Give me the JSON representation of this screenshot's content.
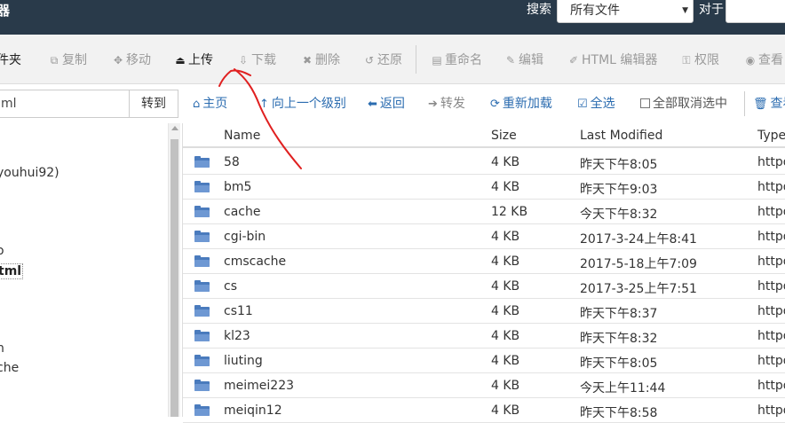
{
  "header": {
    "app_title": "器",
    "search_label": "搜索",
    "search_scope": "所有文件",
    "for_label": "对于",
    "search_placeholder": ""
  },
  "toolbar": {
    "items": [
      {
        "label": "件夹",
        "icon": "folder-icon"
      },
      {
        "label": "复制",
        "icon": "copy-icon"
      },
      {
        "label": "移动",
        "icon": "move-icon"
      },
      {
        "label": "上传",
        "icon": "upload-icon"
      },
      {
        "label": "下载",
        "icon": "download-icon"
      },
      {
        "label": "删除",
        "icon": "delete-icon"
      },
      {
        "label": "还原",
        "icon": "restore-icon"
      },
      {
        "label": "重命名",
        "icon": "file-icon"
      },
      {
        "label": "编辑",
        "icon": "pencil-icon"
      },
      {
        "label": "HTML 编辑器",
        "icon": "edit-icon"
      },
      {
        "label": "权限",
        "icon": "key-icon"
      },
      {
        "label": "查看",
        "icon": "eye-icon"
      }
    ]
  },
  "path": {
    "value": "ml",
    "go_label": "转到"
  },
  "nav": {
    "home": "主页",
    "up_one_level": "向上一个级别",
    "back": "返回",
    "forward": "转发",
    "reload": "重新加载",
    "select_all": "全选",
    "deselect_all": "全部取消选中",
    "view_trash": "查看"
  },
  "tree": {
    "items": [
      "youhui92)",
      "o",
      "tml",
      "n",
      "che"
    ]
  },
  "table": {
    "columns": [
      "Name",
      "Size",
      "Last Modified",
      "Type"
    ],
    "rows": [
      {
        "name": "58",
        "size": "4 KB",
        "modified": "昨天下午8:05",
        "type": "httpd"
      },
      {
        "name": "bm5",
        "size": "4 KB",
        "modified": "昨天下午9:03",
        "type": "httpd"
      },
      {
        "name": "cache",
        "size": "12 KB",
        "modified": "今天下午8:32",
        "type": "httpd"
      },
      {
        "name": "cgi-bin",
        "size": "4 KB",
        "modified": "2017-3-24上午8:41",
        "type": "httpd"
      },
      {
        "name": "cmscache",
        "size": "4 KB",
        "modified": "2017-5-18上午7:09",
        "type": "httpd"
      },
      {
        "name": "cs",
        "size": "4 KB",
        "modified": "2017-3-25上午7:51",
        "type": "httpd"
      },
      {
        "name": "cs11",
        "size": "4 KB",
        "modified": "昨天下午8:37",
        "type": "httpd"
      },
      {
        "name": "kl23",
        "size": "4 KB",
        "modified": "昨天下午8:32",
        "type": "httpd"
      },
      {
        "name": "liuting",
        "size": "4 KB",
        "modified": "昨天下午8:05",
        "type": "httpd"
      },
      {
        "name": "meimei223",
        "size": "4 KB",
        "modified": "今天上午11:44",
        "type": "httpd"
      },
      {
        "name": "meiqin12",
        "size": "4 KB",
        "modified": "昨天下午8:58",
        "type": "httpd"
      }
    ]
  },
  "colors": {
    "header_bg": "#293a4a",
    "toolbar_bg": "#f2f2f2",
    "link": "#2b6cb0",
    "folder": "#4a7bbd",
    "annotation": "#e02020"
  }
}
